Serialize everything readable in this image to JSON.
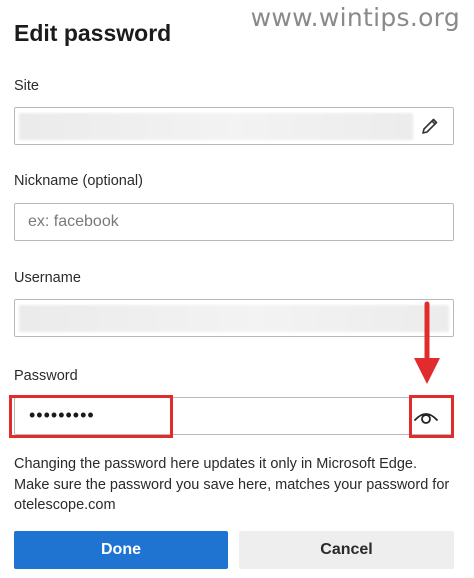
{
  "watermark": "www.wintips.org",
  "dialog": {
    "title": "Edit password",
    "site": {
      "label": "Site",
      "value": "",
      "edit_icon": "pencil-icon"
    },
    "nickname": {
      "label": "Nickname (optional)",
      "value": "",
      "placeholder": "ex: facebook"
    },
    "username": {
      "label": "Username",
      "value": ""
    },
    "password": {
      "label": "Password",
      "masked_value": "•••••••••",
      "reveal_icon": "eye-icon"
    },
    "notice": "Changing the password here updates it only in Microsoft Edge. Make sure the password you save here, matches your password for otelescope.com",
    "buttons": {
      "done": "Done",
      "cancel": "Cancel"
    }
  },
  "annotation": {
    "color": "#e02c2c",
    "arrow_icon": "arrow-down-icon"
  },
  "colors": {
    "primary": "#1f73d1",
    "secondary_button": "#eeeeee"
  }
}
